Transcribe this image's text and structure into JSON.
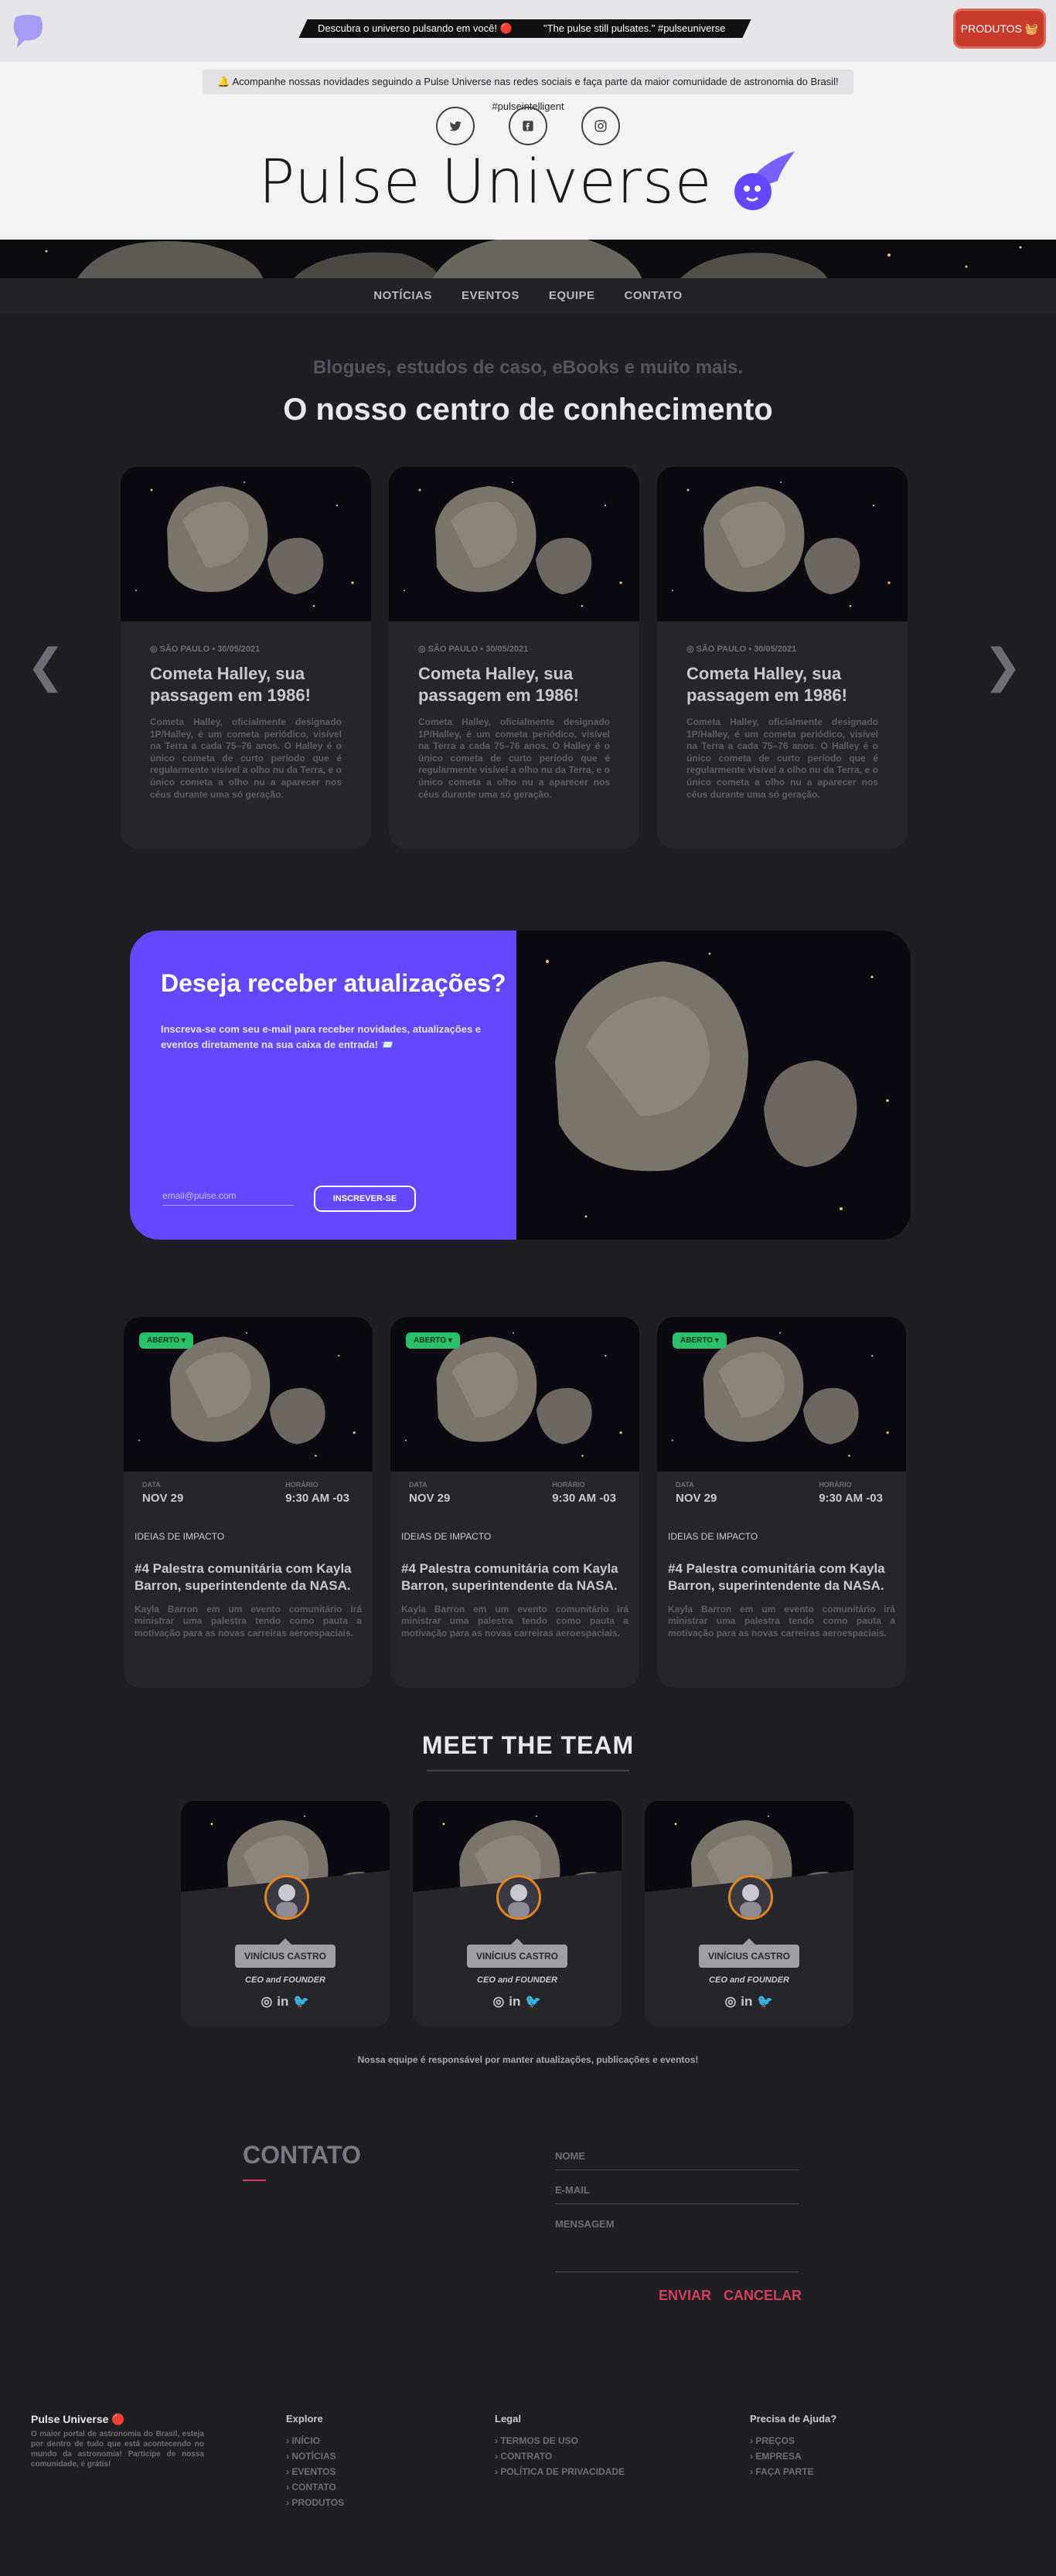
{
  "header": {
    "banner_left": "Descubra o universo pulsando em você! 🔴",
    "banner_right": "\"The pulse still pulsates.\" #pulseuniverse",
    "products_button": "PRODUTOS 🧺",
    "notice": "🔔 Acompanhe nossas novidades seguindo a Pulse Universe nas redes sociais e faça parte da maior comunidade de astronomia do Brasil! #pulseintelligent",
    "brand": "Pulse Universe",
    "social_icons": [
      "twitter-icon",
      "facebook-icon",
      "instagram-icon"
    ]
  },
  "nav": [
    "NOTÍCIAS",
    "EVENTOS",
    "EQUIPE",
    "CONTATO"
  ],
  "knowledge": {
    "subtitle": "Blogues, estudos de caso, eBooks e muito mais.",
    "title": "O nosso centro de conhecimento",
    "cards": [
      {
        "meta": "◎ SÃO PAULO • 30/05/2021",
        "title": "Cometa Halley, sua passagem em 1986!",
        "text": "Cometa Halley, oficialmente designado 1P/Halley, é um cometa periódico, visível na Terra a cada 75–76 anos. O Halley é o único cometa de curto período que é regularmente visível a olho nu da Terra, e o único cometa a olho nu a aparecer nos céus durante uma só geração."
      },
      {
        "meta": "◎ SÃO PAULO • 30/05/2021",
        "title": "Cometa Halley, sua passagem em 1986!",
        "text": "Cometa Halley, oficialmente designado 1P/Halley, é um cometa periódico, visível na Terra a cada 75–76 anos. O Halley é o único cometa de curto período que é regularmente visível a olho nu da Terra, e o único cometa a olho nu a aparecer nos céus durante uma só geração."
      },
      {
        "meta": "◎ SÃO PAULO • 30/05/2021",
        "title": "Cometa Halley, sua passagem em 1986!",
        "text": "Cometa Halley, oficialmente designado 1P/Halley, é um cometa periódico, visível na Terra a cada 75–76 anos. O Halley é o único cometa de curto período que é regularmente visível a olho nu da Terra, e o único cometa a olho nu a aparecer nos céus durante uma só geração."
      }
    ]
  },
  "newsletter": {
    "title": "Deseja receber atualizações?",
    "text": "Inscreva-se com seu e-mail para receber novidades, atualizações e eventos diretamente na sua caixa de entrada! 📨",
    "placeholder": "email@pulse.com",
    "button": "INSCREVER-SE"
  },
  "events": [
    {
      "badge": "ABERTO ▾",
      "date_label": "DATA",
      "date": "NOV 29",
      "time_label": "HORÁRIO",
      "time": "9:30 AM -03",
      "category": "IDEIAS DE IMPACTO",
      "title": "#4 Palestra comunitária com Kayla Barron, superintendente da NASA.",
      "text": "Kayla Barron em um evento comunitário irá ministrar uma palestra tendo como pauta a motivação para as novas carreiras aeroespaciais."
    },
    {
      "badge": "ABERTO ▾",
      "date_label": "DATA",
      "date": "NOV 29",
      "time_label": "HORÁRIO",
      "time": "9:30 AM -03",
      "category": "IDEIAS DE IMPACTO",
      "title": "#4 Palestra comunitária com Kayla Barron, superintendente da NASA.",
      "text": "Kayla Barron em um evento comunitário irá ministrar uma palestra tendo como pauta a motivação para as novas carreiras aeroespaciais."
    },
    {
      "badge": "ABERTO ▾",
      "date_label": "DATA",
      "date": "NOV 29",
      "time_label": "HORÁRIO",
      "time": "9:30 AM -03",
      "category": "IDEIAS DE IMPACTO",
      "title": "#4 Palestra comunitária com Kayla Barron, superintendente da NASA.",
      "text": "Kayla Barron em um evento comunitário irá ministrar uma palestra tendo como pauta a motivação para as novas carreiras aeroespaciais."
    }
  ],
  "team": {
    "title": "MEET THE TEAM",
    "members": [
      {
        "name": "VINÍCIUS CASTRO",
        "role": "CEO and FOUNDER"
      },
      {
        "name": "VINÍCIUS CASTRO",
        "role": "CEO and FOUNDER"
      },
      {
        "name": "VINÍCIUS CASTRO",
        "role": "CEO and FOUNDER"
      }
    ],
    "note": "Nossa equipe é responsável por manter atualizações, publicações e eventos!"
  },
  "contact": {
    "title": "CONTATO",
    "name_placeholder": "NOME",
    "email_placeholder": "E-MAIL",
    "message_placeholder": "MENSAGEM",
    "send": "ENVIAR",
    "cancel": "CANCELAR"
  },
  "footer": {
    "brand": "Pulse Universe 🔴",
    "about": "O maior portal de astronomia do Brasil, esteja por dentro de tudo que está acontecendo no mundo da astronomia! Participe de nossa comunidade, é grátis!",
    "columns": [
      {
        "title": "Explore",
        "items": [
          "INÍCIO",
          "NOTÍCIAS",
          "EVENTOS",
          "CONTATO",
          "PRODUTOS"
        ]
      },
      {
        "title": "Legal",
        "items": [
          "TERMOS DE USO",
          "CONTRATO",
          "POLÍTICA DE PRIVACIDADE"
        ]
      },
      {
        "title": "Precisa de Ajuda?",
        "items": [
          "PREÇOS",
          "EMPRESA",
          "FAÇA PARTE"
        ]
      }
    ]
  },
  "colors": {
    "accent": "#6348ff",
    "red": "#c83a2c",
    "pink": "#d2405c",
    "green": "#2bbf6a",
    "bg": "#1f1e24"
  }
}
